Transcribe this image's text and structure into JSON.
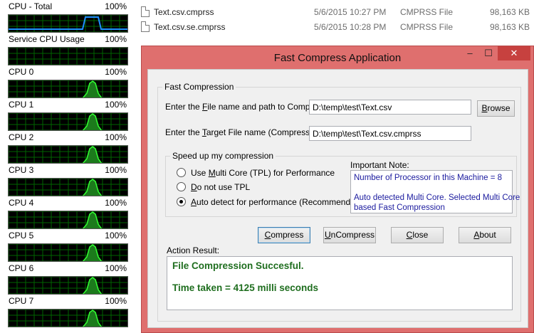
{
  "cpu_monitor": {
    "total": {
      "name": "CPU - Total",
      "percent": "100%"
    },
    "service": {
      "name": "Service CPU Usage",
      "percent": "100%"
    },
    "cores": [
      {
        "name": "CPU 0",
        "percent": "100%"
      },
      {
        "name": "CPU 1",
        "percent": "100%"
      },
      {
        "name": "CPU 2",
        "percent": "100%"
      },
      {
        "name": "CPU 3",
        "percent": "100%"
      },
      {
        "name": "CPU 4",
        "percent": "100%"
      },
      {
        "name": "CPU 5",
        "percent": "100%"
      },
      {
        "name": "CPU 6",
        "percent": "100%"
      },
      {
        "name": "CPU 7",
        "percent": "100%"
      }
    ],
    "colors": {
      "graph_bg": "#000000",
      "grid": "#006400",
      "core_line": "#32ff32",
      "total_line": "#1e90ff"
    }
  },
  "file_list": {
    "rows": [
      {
        "name": "Text.csv.cmprss",
        "date": "5/6/2015 10:27 PM",
        "type": "CMPRSS File",
        "size": "98,163 KB",
        "icon": "file-icon"
      },
      {
        "name": "Text.csv.se.cmprss",
        "date": "5/6/2015 10:28 PM",
        "type": "CMPRSS File",
        "size": "98,163 KB",
        "icon": "file-icon"
      }
    ]
  },
  "window": {
    "title": "Fast Compress Application",
    "minimize": "–",
    "maximize": "☐",
    "close": "✕",
    "title_bar_color": "#df6f6e"
  },
  "fast_compression": {
    "group_label": "Fast Compression",
    "source": {
      "label_pre": "Enter the ",
      "label_key": "F",
      "label_post": "ile name and path to Compress:",
      "value": "D:\\temp\\test\\Text.csv"
    },
    "browse_button": {
      "key": "B",
      "rest": "rowse"
    },
    "target": {
      "label_pre": "Enter the ",
      "label_key": "T",
      "label_post": "arget File name (Compressed) :",
      "value": "D:\\temp\\test\\Text.csv.cmprss"
    },
    "speed_group": {
      "label": "Speed up my compression",
      "options": [
        {
          "pre": "Use ",
          "key": "M",
          "post": "ulti Core (TPL) for Performance",
          "checked": false
        },
        {
          "pre": "",
          "key": "D",
          "post": "o not use TPL",
          "checked": false
        },
        {
          "pre": "",
          "key": "A",
          "post": "uto detect for performance (Recommended)",
          "checked": true
        }
      ]
    },
    "important_note": {
      "label": "Important Note:",
      "line1": "Number of Processor in this Machine = 8",
      "line2": "",
      "line3": "Auto detected Multi Core.  Selected Multi Core",
      "line4": "based Fast Compression"
    },
    "buttons": {
      "compress": {
        "key": "C",
        "rest": "ompress"
      },
      "uncompress": {
        "key": "U",
        "rest": "nCompress"
      },
      "close": {
        "key": "C",
        "rest": "lose"
      },
      "about": {
        "key": "A",
        "rest": "bout"
      }
    },
    "action_result": {
      "label": "Action Result:",
      "line1": "File Compression Succesful.",
      "line2": "Time taken = 4125 milli seconds",
      "text_color": "#1f6e1f"
    }
  }
}
